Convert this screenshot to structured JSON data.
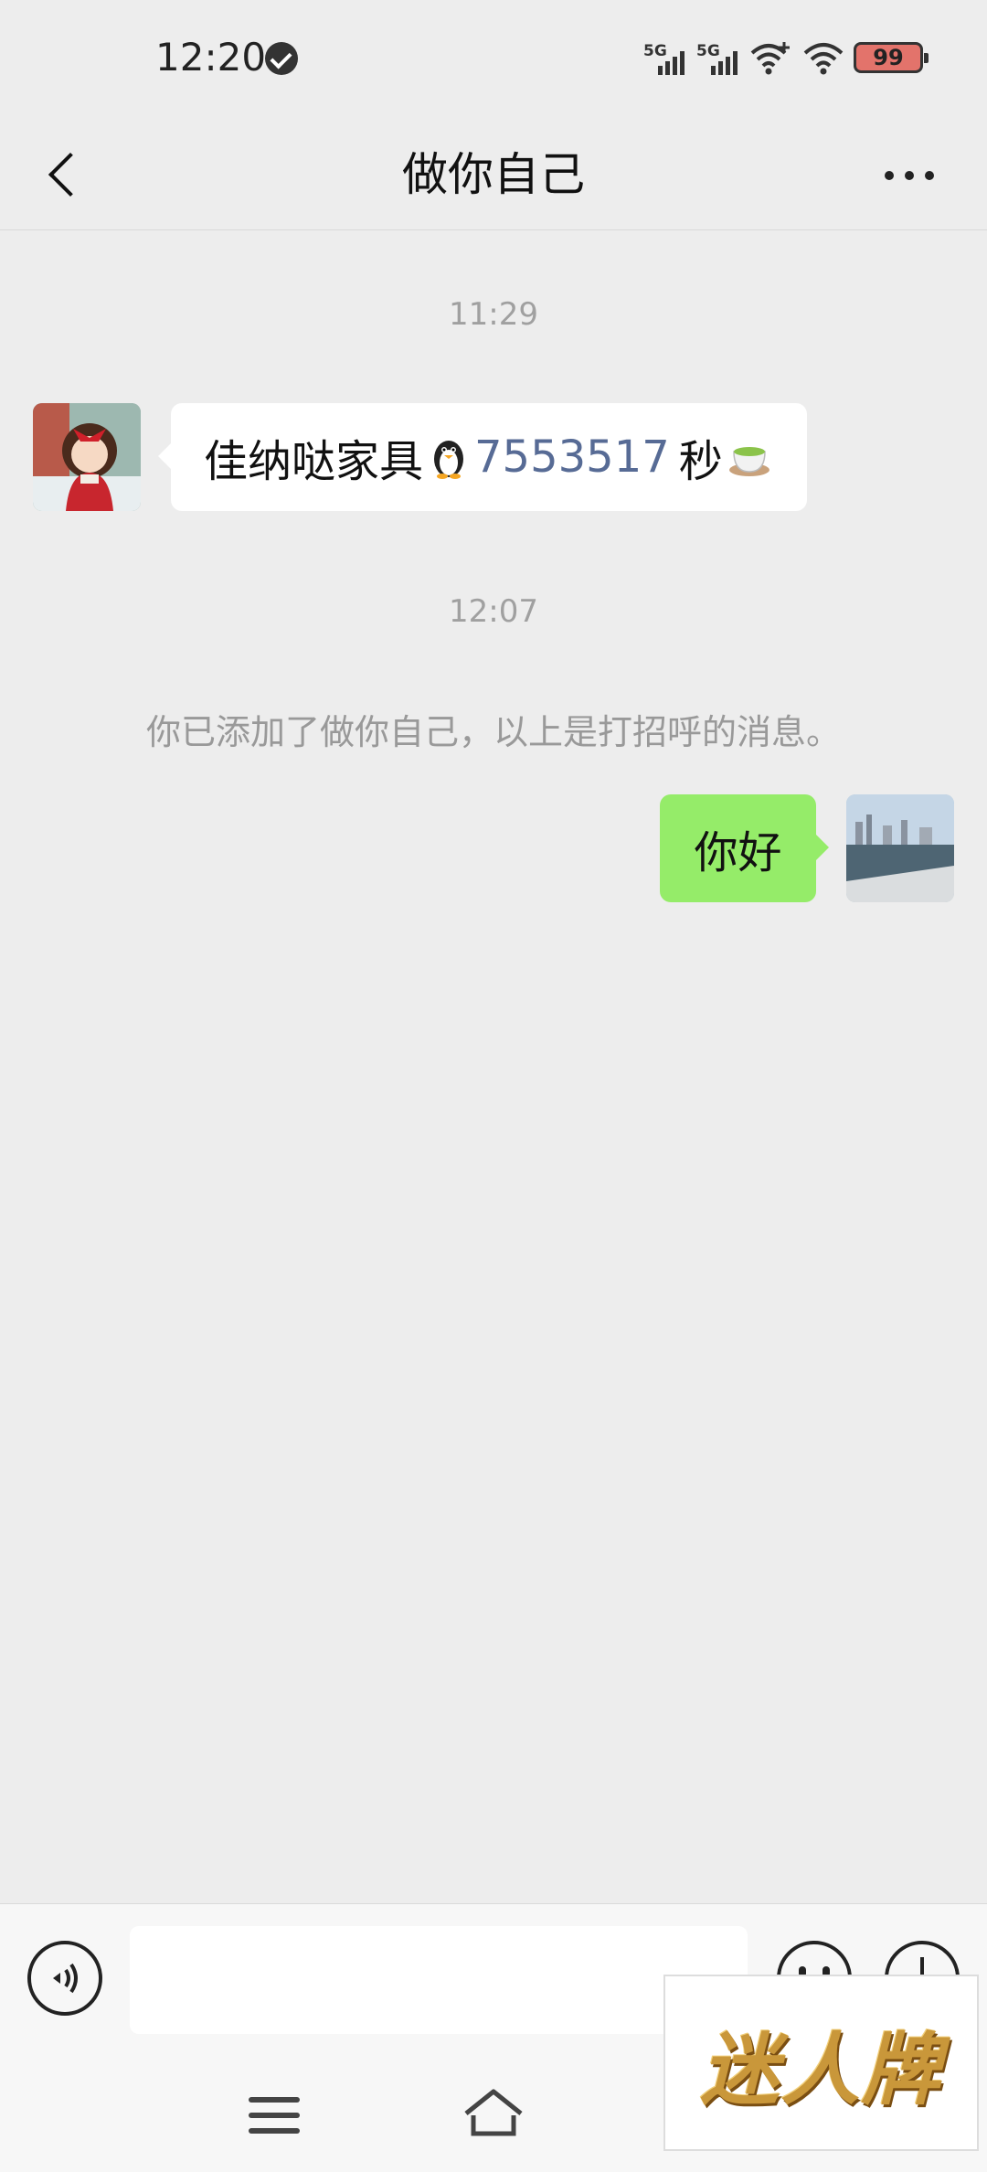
{
  "status_bar": {
    "time": "12:20",
    "sim1_label": "5G",
    "sim2_label": "5G",
    "battery_level": "99",
    "icons": [
      "verified-check-icon",
      "signal-5g-icon",
      "signal-5g-icon",
      "wifi-plus-icon",
      "wifi-icon",
      "battery-icon"
    ]
  },
  "nav": {
    "title": "做你自己",
    "back_icon": "chevron-left-icon",
    "more_icon": "more-horizontal-icon"
  },
  "chat": {
    "timestamp_1": "11:29",
    "incoming_message": {
      "text_before": "佳纳哒家具",
      "link_number": "7553517",
      "text_after": "秒",
      "emojis": [
        "penguin-emoji",
        "tea-emoji"
      ]
    },
    "timestamp_2": "12:07",
    "system_message": "你已添加了做你自己，以上是打招呼的消息。",
    "outgoing_message": {
      "text": "你好"
    }
  },
  "input_bar": {
    "value": "",
    "icons": [
      "voice-icon",
      "emoji-icon",
      "plus-icon"
    ]
  },
  "system_nav": {
    "icons": [
      "menu-icon",
      "home-icon"
    ]
  },
  "watermark": {
    "text": "迷人牌"
  },
  "colors": {
    "background": "#EDEDED",
    "outgoing_bubble": "#95EC69",
    "incoming_bubble": "#FFFFFF",
    "link": "#576B95",
    "timestamp": "#A0A0A0",
    "battery_fill": "#E3736B"
  }
}
